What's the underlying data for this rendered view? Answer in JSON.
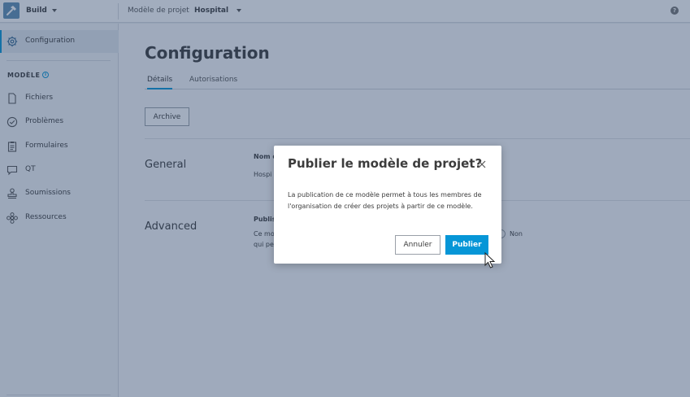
{
  "topbar": {
    "app_name": "Build",
    "crumb_label": "Modèle de projet",
    "crumb_value": "Hospital",
    "help_glyph": "?"
  },
  "sidebar": {
    "active_item": "Configuration",
    "section_label": "MODÈLE",
    "info_glyph": "i",
    "items": [
      {
        "label": "Fichiers",
        "icon": "file-icon"
      },
      {
        "label": "Problèmes",
        "icon": "check-circle-icon"
      },
      {
        "label": "Formulaires",
        "icon": "clipboard-icon"
      },
      {
        "label": "QT",
        "icon": "speech-bubble-icon"
      },
      {
        "label": "Soumissions",
        "icon": "stamp-icon"
      },
      {
        "label": "Ressources",
        "icon": "asset-icon"
      }
    ]
  },
  "main": {
    "title": "Configuration",
    "tabs": [
      {
        "label": "Détails",
        "active": true
      },
      {
        "label": "Autorisations",
        "active": false
      }
    ],
    "archive_label": "Archive",
    "sections": {
      "general": {
        "title": "General",
        "field_label": "Nom d",
        "field_value": "Hospi"
      },
      "advanced": {
        "title": "Advanced",
        "field_label": "Publis",
        "desc_line1": "Ce mo",
        "desc_line2": "qui pe",
        "radio_no_label": "Non"
      }
    }
  },
  "dialog": {
    "title": "Publier le modèle de projet?",
    "body": "La publication de ce modèle permet à tous les membres de l'organisation de créer des projets à partir de ce modèle.",
    "cancel_label": "Annuler",
    "confirm_label": "Publier"
  },
  "colors": {
    "accent": "#0696d7",
    "overlay": "rgba(40,64,104,0.43)",
    "app_logo": "#5f8fb4"
  }
}
